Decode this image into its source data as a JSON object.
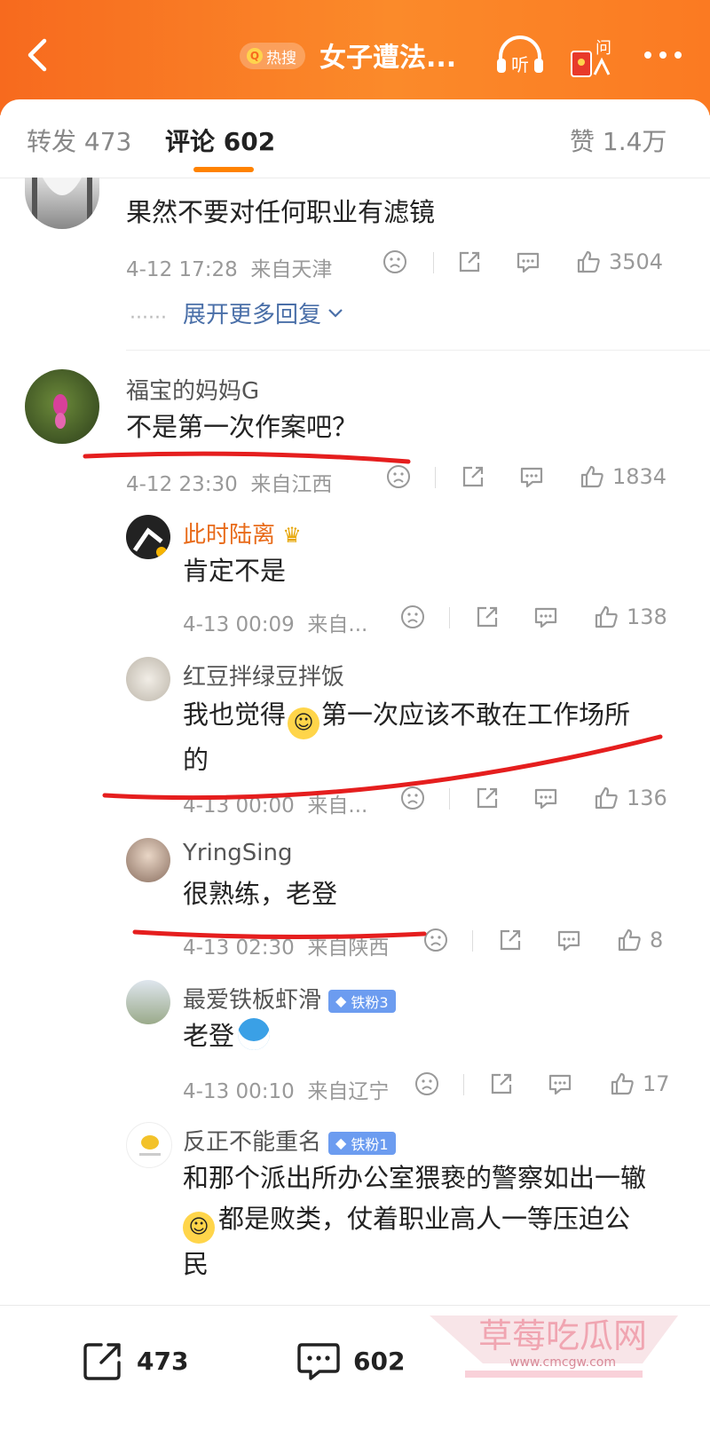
{
  "header": {
    "hot_label": "热搜",
    "title": "女子遭法...",
    "listen_label": "听",
    "ask_label": "问"
  },
  "tabs": {
    "repost": "转发 473",
    "comments": "评论 602",
    "likes": "赞 1.4万"
  },
  "comments": [
    {
      "user": "",
      "text": "果然不要对任何职业有滤镜",
      "time": "4-12 17:28",
      "location": "来自天津",
      "likes": "3504",
      "expand": "展开更多回复"
    },
    {
      "user": "福宝的妈妈G",
      "text": "不是第一次作案吧？",
      "time": "4-12 23:30",
      "location": "来自江西",
      "likes": "1834"
    }
  ],
  "replies": [
    {
      "user": "此时陆离",
      "text": "肯定不是",
      "time": "4-13 00:09",
      "location": "来自...",
      "likes": "138"
    },
    {
      "user": "红豆拌绿豆拌饭",
      "text1": "我也觉得",
      "text2": "第一次应该不敢在工作场所",
      "text3": "的",
      "time": "4-13 00:00",
      "location": "来自...",
      "likes": "136"
    },
    {
      "user": "YringSing",
      "text": "很熟练，老登",
      "time": "4-13 02:30",
      "location": "来自陕西",
      "likes": "8"
    },
    {
      "user": "最爱铁板虾滑",
      "badge": "铁粉3",
      "text": "老登",
      "time": "4-13 00:10",
      "location": "来自辽宁",
      "likes": "17"
    },
    {
      "user": "反正不能重名",
      "badge": "铁粉1",
      "line1": "和那个派出所办公室猥亵的警察如出一辙",
      "line2": "都是败类，仗着职业高人一等压迫公",
      "line3": "民"
    }
  ],
  "bottom_bar": {
    "reposts": "473",
    "comments": "602"
  },
  "watermark": {
    "name": "草莓吃瓜网",
    "url": "www.cmcgw.com"
  },
  "colors": {
    "header_orange": "#f76a1e",
    "accent": "#ff8200",
    "red_mark": "#e51e1e"
  }
}
